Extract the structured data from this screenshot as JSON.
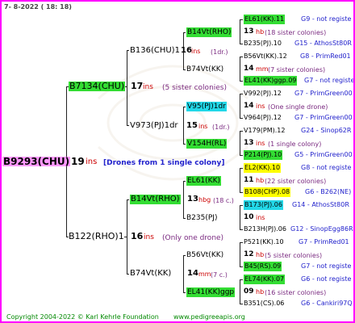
{
  "date": "7- 8-2022 ( 18: 18)",
  "footer": {
    "copyright": "Copyright 2004-2022 © Karl Kehrle Foundation",
    "url": "www.pedigreeapis.org"
  },
  "colors": {
    "border": "#ff00ff",
    "green": "#33dd33",
    "cyan": "#22d8e8",
    "yellow": "#ffff00",
    "pink": "#ff99ff",
    "ins": "#cc0000",
    "note": "#7a2a80",
    "right": "#2222cc"
  },
  "root": {
    "name": "B9293(CHU)",
    "ins": "19",
    "ins_word": "ins",
    "note": "[Drones from 1 single colony]"
  },
  "l1_top": {
    "name": "B7134(CHU)",
    "ins": "17",
    "ins_word": "ins",
    "note": "(5 sister colonies)"
  },
  "l1_bot": {
    "name": "B122(RHO)1",
    "ins": "16",
    "ins_word": "ins",
    "note": "(Only one drone)"
  },
  "l2": [
    {
      "name": "B136(CHU)1",
      "ins": "16",
      "ins_word": "ins",
      "note": "(1dr.)"
    },
    {
      "name": "V973(PJ)1dr",
      "ins": "15",
      "ins_word": "ins",
      "note": "(1dr.)"
    },
    {
      "name": "B14Vt(RHO)",
      "ins": "13",
      "ins_word": "hbg",
      "note": "(18 c.)"
    },
    {
      "name": "B74Vt(KK)",
      "ins": "14",
      "ins_word": "mm",
      "note": "(7 c.)"
    }
  ],
  "l3": [
    {
      "name": "B14Vt(RHO)"
    },
    {
      "name": "B74Vt(KK)"
    },
    {
      "name": "V95(PJ)1dr"
    },
    {
      "name": "V154H(RL)"
    },
    {
      "name": "EL61(KK)"
    },
    {
      "name": "B235(PJ)",
      "ins": "10",
      "ins_word": "ins"
    },
    {
      "name": "B56Vt(KK)"
    },
    {
      "name": "EL41(KK)ggp"
    }
  ],
  "l4": [
    {
      "name": "EL61(KK).11",
      "right": "G9 - not registe"
    },
    {
      "num": "13",
      "unit": "hb",
      "note": "(18 sister colonies)"
    },
    {
      "name": "B235(PJ).10",
      "right": "G15 - AthosSt80R"
    },
    {
      "name": "B56Vt(KK).12",
      "right": "G8 - PrimRed01"
    },
    {
      "num": "14",
      "unit": "mm",
      "note": "(7 sister colonies)"
    },
    {
      "name": "EL41(KK)ggp.09",
      "right": "G7 - not registe"
    },
    {
      "name": "V992(PJ).12",
      "right": "G7 - PrimGreen00"
    },
    {
      "num": "14",
      "unit": "ins",
      "note": "(One single drone)"
    },
    {
      "name": "V964(PJ).12",
      "right": "G7 - PrimGreen00"
    },
    {
      "name": "V179(PM).12",
      "right": "G24 - Sinop62R"
    },
    {
      "num": "13",
      "unit": "ins",
      "note": "(1 single colony)"
    },
    {
      "name": "P214(PJ).10",
      "right": "G5 - PrimGreen00"
    },
    {
      "name": "EL2(KK).10",
      "right": "G8 - not registe"
    },
    {
      "num": "11",
      "unit": "hb",
      "note": "(22 sister colonies)"
    },
    {
      "name": "B108(CHP).08",
      "right": "G6 - B262(NE)"
    },
    {
      "name": "B173(PJ).06",
      "right": "G14 - AthosSt80R"
    },
    {
      "num": "10",
      "unit": "ins",
      "note": ""
    },
    {
      "name": "B213H(PJ).06",
      "right": "G12 - SinopEgg86R"
    },
    {
      "name": "P521(KK).10",
      "right": "G7 - PrimRed01"
    },
    {
      "num": "12",
      "unit": "hb",
      "note": "(5 sister colonies)"
    },
    {
      "name": "B45(RS).09",
      "right": "G7 - not registe"
    },
    {
      "name": "EL74(KK).07",
      "right": "G6 - not registe"
    },
    {
      "num": "09",
      "unit": "hb",
      "note": "(16 sister colonies)"
    },
    {
      "name": "B351(CS).06",
      "right": "G6 - Cankiri97Q"
    }
  ]
}
